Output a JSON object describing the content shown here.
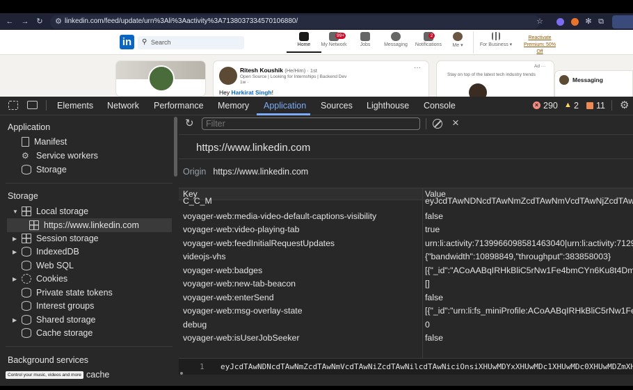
{
  "browser": {
    "url": "linkedin.com/feed/update/urn%3Ali%3Aactivity%3A7138037334570106880/"
  },
  "linkedin": {
    "logo": "in",
    "search_placeholder": "Search",
    "nav": [
      {
        "label": "Home",
        "badge": ""
      },
      {
        "label": "My Network",
        "badge": "99+"
      },
      {
        "label": "Jobs",
        "badge": ""
      },
      {
        "label": "Messaging",
        "badge": ""
      },
      {
        "label": "Notifications",
        "badge": "2"
      },
      {
        "label": "Me ▾",
        "badge": ""
      },
      {
        "label": "For Business ▾",
        "badge": ""
      }
    ],
    "premium": {
      "line1": "Reactivate",
      "line2": "Premium: 50%",
      "line3": "Off"
    },
    "post": {
      "author": "Ritesh Koushik",
      "pronouns": "(He/Him) · 1st",
      "headline": "Open Source | Looking for Internships | Backend Dev",
      "time": "1w · ",
      "greeting": "Hey",
      "mention": "Harkirat Singh",
      "greeting_end": "!",
      "more": "···"
    },
    "ad": {
      "label": "Ad ···",
      "text": "Stay on top of the latest tech industry trends"
    },
    "messaging": "Messaging"
  },
  "devtools": {
    "tabs": [
      {
        "label": "Elements",
        "active": false
      },
      {
        "label": "Network",
        "active": false
      },
      {
        "label": "Performance",
        "active": false
      },
      {
        "label": "Memory",
        "active": false
      },
      {
        "label": "Application",
        "active": true
      },
      {
        "label": "Sources",
        "active": false
      },
      {
        "label": "Lighthouse",
        "active": false
      },
      {
        "label": "Console",
        "active": false
      }
    ],
    "counts": {
      "errors": "290",
      "warnings": "2",
      "issues": "11"
    },
    "colors": {
      "error": "#f28b82",
      "warning": "#fdd663",
      "issue": "#ee8a55",
      "active_tab": "#7cacf8"
    },
    "sidebar": {
      "application_header": "Application",
      "application_items": [
        "Manifest",
        "Service workers",
        "Storage"
      ],
      "storage_header": "Storage",
      "storage_items": [
        {
          "label": "Local storage",
          "expanded": true
        },
        {
          "label": "https://www.linkedin.com",
          "selected": true
        },
        {
          "label": "Session storage"
        },
        {
          "label": "IndexedDB"
        },
        {
          "label": "Web SQL"
        },
        {
          "label": "Cookies"
        },
        {
          "label": "Private state tokens"
        },
        {
          "label": "Interest groups"
        },
        {
          "label": "Shared storage"
        },
        {
          "label": "Cache storage"
        }
      ],
      "background_header": "Background services",
      "partial_item": "cache",
      "toast": "Control your music, videos and more"
    },
    "filter_placeholder": "Filter",
    "origin_title": "https://www.linkedin.com",
    "origin_label": "Origin",
    "origin_value": "https://www.linkedin.com",
    "table": {
      "columns": [
        "Key",
        "Value"
      ],
      "rows": [
        {
          "key": "C_C_M",
          "value": "eyJcdTAwNDNcdTAwNmZcdTAwNmVcdTAwNjZcdTAwNmVcdTAwN"
        },
        {
          "key": "voyager-web:media-video-default-captions-visibility",
          "value": "false"
        },
        {
          "key": "voyager-web:video-playing-tab",
          "value": "true"
        },
        {
          "key": "voyager-web:feedInitialRequestUpdates",
          "value": "urn:li:activity:7139966098581463040|urn:li:activity:7129"
        },
        {
          "key": "videojs-vhs",
          "value": "{\"bandwidth\":10898849,\"throughput\":383858003}"
        },
        {
          "key": "voyager-web:badges",
          "value": "[{\"_id\":\"ACoAABqIRHkBliC5rNw1Fe4bmCYn6Ku8t4Dm"
        },
        {
          "key": "voyager-web:new-tab-beacon",
          "value": "[]"
        },
        {
          "key": "voyager-web:enterSend",
          "value": "false"
        },
        {
          "key": "voyager-web:msg-overlay-state",
          "value": "[{\"_id\":\"urn:li:fs_miniProfile:ACoAABqIRHkBliC5rNw1Fe"
        },
        {
          "key": "debug",
          "value": "0"
        },
        {
          "key": "voyager-web:isUserJobSeeker",
          "value": "false"
        }
      ]
    },
    "preview": {
      "line_number": "1",
      "text": "eyJcdTAwNDNcdTAwNmZcdTAwNmVcdTAwNiZcdTAwNilcdTAwNiciOnsiXHUwMDYxXHUwMDc1XHUwMDc0XHUwMDZmXHU"
    }
  }
}
